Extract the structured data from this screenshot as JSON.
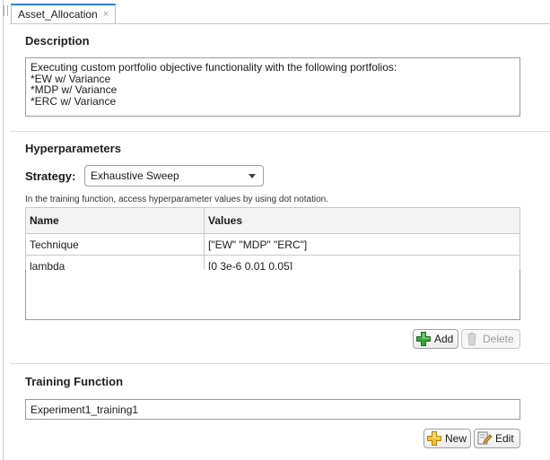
{
  "tab": {
    "label": "Asset_Allocation",
    "close_glyph": "×"
  },
  "description": {
    "title": "Description",
    "lines": [
      "Executing custom portfolio objective functionality with the following portfolios:",
      "*EW w/ Variance",
      "*MDP w/ Variance",
      "*ERC w/ Variance"
    ]
  },
  "hyperparameters": {
    "title": "Hyperparameters",
    "strategy_label": "Strategy:",
    "strategy_value": "Exhaustive Sweep",
    "hint": "In the training function, access hyperparameter values by using dot notation.",
    "columns": [
      "Name",
      "Values"
    ],
    "rows": [
      {
        "name": "Technique",
        "values": "[\"EW\" \"MDP\" \"ERC\"]"
      },
      {
        "name": "lambda",
        "values": "[0 3e-6 0.01 0.05]"
      }
    ],
    "add_label": "Add",
    "delete_label": "Delete"
  },
  "training_function": {
    "title": "Training Function",
    "value": "Experiment1_training1",
    "new_label": "New",
    "edit_label": "Edit"
  },
  "colors": {
    "accent": "#2f7bd5",
    "add_icon_green": "#3aa63a",
    "new_icon_yellow": "#f2c12e"
  }
}
